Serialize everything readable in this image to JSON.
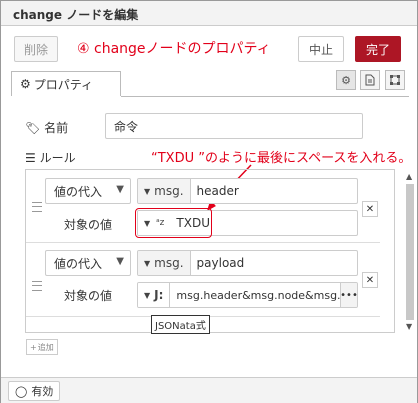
{
  "title": "change ノードを編集",
  "buttons": {
    "delete": "削除",
    "cancel": "中止",
    "done": "完了"
  },
  "annotation": "④ changeノードのプロパティ",
  "callout": "“TXDU ”のように最後にスペースを入れる。",
  "tabs": [
    {
      "label": "プロパティ",
      "icon": "gear-icon"
    }
  ],
  "tab_icons": [
    "gear-icon",
    "description-icon",
    "appearance-icon"
  ],
  "name": {
    "label": "名前",
    "value": "命令"
  },
  "rules": {
    "label": "ルール",
    "items": [
      {
        "action": "値の代入",
        "target_type": "msg.",
        "target": "header",
        "value_label": "対象の値",
        "value_type_icon": "string-icon",
        "value": "TXDU "
      },
      {
        "action": "値の代入",
        "target_type": "msg.",
        "target": "payload",
        "value_label": "対象の値",
        "value_type_icon": "jsonata-icon",
        "value": "msg.header&msg.node&msg.mach"
      }
    ],
    "tooltip": "JSONata式",
    "add_label": "追加"
  },
  "footer": {
    "enabled_label": "有効"
  },
  "colors": {
    "accent": "#ad1625",
    "annotation": "#e2001a"
  }
}
